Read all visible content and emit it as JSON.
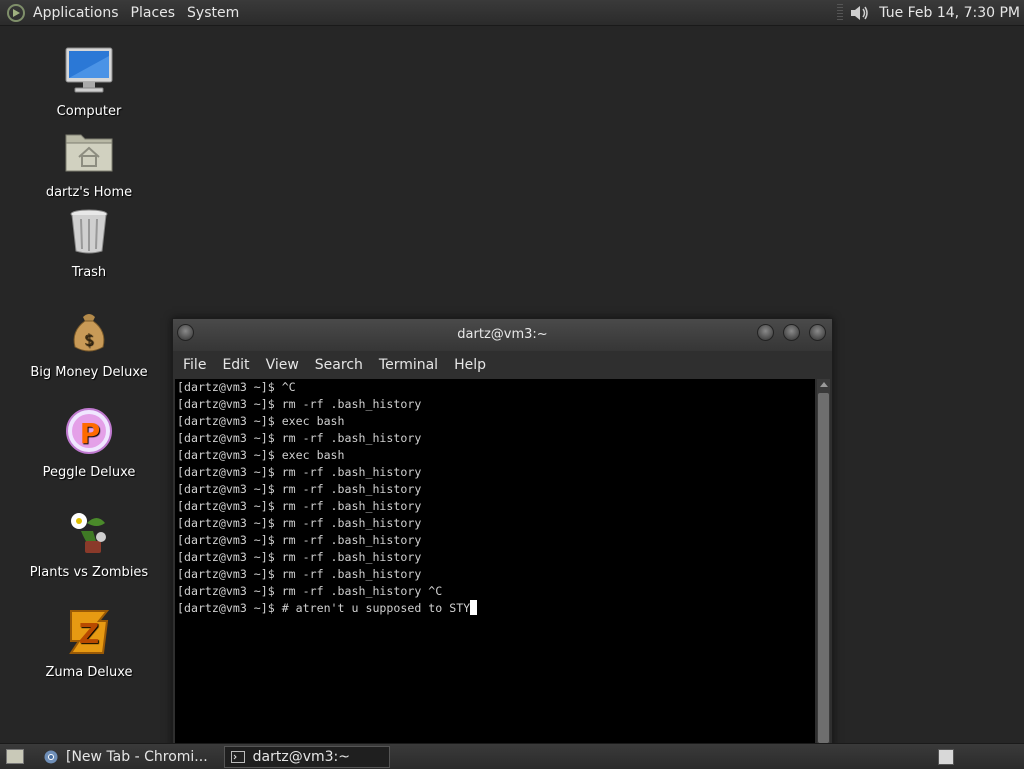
{
  "top_panel": {
    "menus": [
      "Applications",
      "Places",
      "System"
    ],
    "clock": "Tue Feb 14,  7:30 PM"
  },
  "desktop_icons": [
    {
      "label": "Computer",
      "icon": "computer-icon"
    },
    {
      "label": "dartz's Home",
      "icon": "home-folder-icon"
    },
    {
      "label": "Trash",
      "icon": "trash-icon"
    },
    {
      "label": "Big Money Deluxe",
      "icon": "money-bag-icon"
    },
    {
      "label": "Peggle Deluxe",
      "icon": "peggle-icon"
    },
    {
      "label": "Plants vs Zombies",
      "icon": "plants-vs-zombies-icon"
    },
    {
      "label": "Zuma Deluxe",
      "icon": "zuma-icon"
    }
  ],
  "terminal": {
    "title": "dartz@vm3:~",
    "menus": [
      "File",
      "Edit",
      "View",
      "Search",
      "Terminal",
      "Help"
    ],
    "lines": [
      "[dartz@vm3 ~]$ ^C",
      "[dartz@vm3 ~]$ rm -rf .bash_history",
      "[dartz@vm3 ~]$ exec bash",
      "[dartz@vm3 ~]$ rm -rf .bash_history",
      "[dartz@vm3 ~]$ exec bash",
      "[dartz@vm3 ~]$ rm -rf .bash_history",
      "[dartz@vm3 ~]$ rm -rf .bash_history",
      "[dartz@vm3 ~]$ rm -rf .bash_history",
      "[dartz@vm3 ~]$ rm -rf .bash_history",
      "[dartz@vm3 ~]$ rm -rf .bash_history",
      "[dartz@vm3 ~]$ rm -rf .bash_history",
      "[dartz@vm3 ~]$ rm -rf .bash_history",
      "[dartz@vm3 ~]$ rm -rf .bash_history ^C",
      "[dartz@vm3 ~]$ # atren't u supposed to STY"
    ]
  },
  "taskbar": {
    "tasks": [
      {
        "label": "[New Tab - Chromi...",
        "icon": "chromium-icon",
        "active": false
      },
      {
        "label": "dartz@vm3:~",
        "icon": "terminal-icon",
        "active": true
      }
    ]
  }
}
